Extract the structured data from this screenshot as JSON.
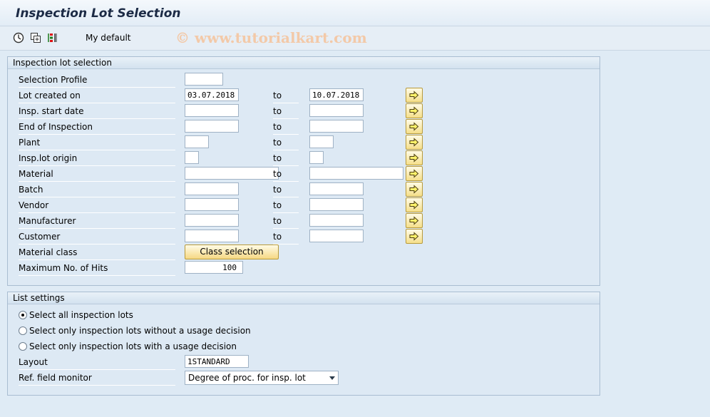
{
  "header": {
    "title": "Inspection Lot Selection"
  },
  "toolbar": {
    "icons": [
      "execute-icon",
      "get-variant-icon",
      "selection-options-icon"
    ],
    "variant_label": "My default",
    "watermark": "© www.tutorialkart.com"
  },
  "selection": {
    "title": "Inspection lot selection",
    "to_label": "to",
    "rows": [
      {
        "label": "Selection Profile",
        "low": "",
        "high": null
      },
      {
        "label": "Lot created on",
        "low": "03.07.2018",
        "high": "10.07.2018"
      },
      {
        "label": "Insp. start date",
        "low": "",
        "high": ""
      },
      {
        "label": "End of Inspection",
        "low": "",
        "high": ""
      },
      {
        "label": "Plant",
        "low": "",
        "high": ""
      },
      {
        "label": "Insp.lot origin",
        "low": "",
        "high": ""
      },
      {
        "label": "Material",
        "low": "",
        "high": ""
      },
      {
        "label": "Batch",
        "low": "",
        "high": ""
      },
      {
        "label": "Vendor",
        "low": "",
        "high": ""
      },
      {
        "label": "Manufacturer",
        "low": "",
        "high": ""
      },
      {
        "label": "Customer",
        "low": "",
        "high": ""
      },
      {
        "label": "Material class",
        "button": "Class selection"
      },
      {
        "label": "Maximum No. of Hits",
        "value": "100"
      }
    ]
  },
  "list_settings": {
    "title": "List settings",
    "radios": [
      {
        "label": "Select all inspection lots",
        "checked": true
      },
      {
        "label": "Select only inspection lots without a usage decision",
        "checked": false
      },
      {
        "label": "Select only inspection lots with a usage decision",
        "checked": false
      }
    ],
    "layout_label": "Layout",
    "layout_value": "1STANDARD",
    "ref_label": "Ref. field monitor",
    "ref_value": "Degree of proc. for insp. lot"
  },
  "colors": {
    "background": "#dfebf5",
    "button": "#f5df8a",
    "title": "#1b2a45"
  }
}
